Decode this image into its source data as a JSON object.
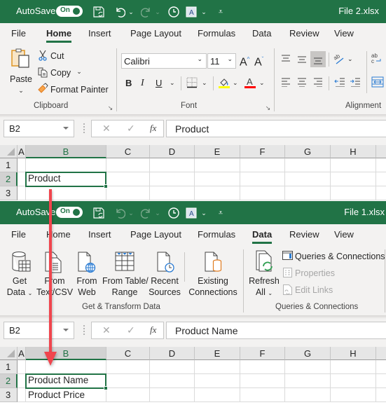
{
  "windows": [
    {
      "title_bar": {
        "autosave_label": "AutoSave",
        "autosave_state": "On",
        "file_name": "File 2.xlsx",
        "qat_icons": [
          "save-sync-icon",
          "undo-icon",
          "redo-icon",
          "history-icon",
          "format-icon",
          "customize-icon"
        ]
      },
      "tabs": [
        {
          "label": "File",
          "active": false
        },
        {
          "label": "Home",
          "active": true
        },
        {
          "label": "Insert",
          "active": false
        },
        {
          "label": "Page Layout",
          "active": false
        },
        {
          "label": "Formulas",
          "active": false
        },
        {
          "label": "Data",
          "active": false
        },
        {
          "label": "Review",
          "active": false
        },
        {
          "label": "View",
          "active": false
        }
      ],
      "ribbon": {
        "clipboard": {
          "paste": "Paste",
          "cut": "Cut",
          "copy": "Copy",
          "format_painter": "Format Painter",
          "group_label": "Clipboard"
        },
        "font": {
          "font_name": "Calibri",
          "font_size": "11",
          "bold": "B",
          "italic": "I",
          "underline": "U",
          "highlight_color": "#ffff00",
          "font_color": "#ff0000",
          "group_label": "Font"
        },
        "alignment": {
          "group_label": "Alignment"
        }
      },
      "formula_bar": {
        "name_box": "B2",
        "cancel": "✕",
        "enter": "✓",
        "fx": "fx",
        "value": "Product"
      },
      "grid": {
        "columns": [
          "A",
          "B",
          "C",
          "D",
          "E",
          "F",
          "G",
          "H"
        ],
        "rows": [
          "1",
          "2",
          "3"
        ],
        "active_cell": "B2",
        "cells": {
          "B2": "Product"
        }
      }
    },
    {
      "title_bar": {
        "autosave_label": "AutoSave",
        "autosave_state": "On",
        "file_name": "File 1.xlsx",
        "qat_icons": [
          "save-sync-icon",
          "undo-icon",
          "redo-icon",
          "history-icon",
          "format-icon",
          "customize-icon"
        ]
      },
      "tabs": [
        {
          "label": "File",
          "active": false
        },
        {
          "label": "Home",
          "active": false
        },
        {
          "label": "Insert",
          "active": false
        },
        {
          "label": "Page Layout",
          "active": false
        },
        {
          "label": "Formulas",
          "active": false
        },
        {
          "label": "Data",
          "active": true
        },
        {
          "label": "Review",
          "active": false
        },
        {
          "label": "View",
          "active": false
        }
      ],
      "ribbon": {
        "get_transform": {
          "get_data": [
            "Get",
            "Data"
          ],
          "from_text_csv": [
            "From",
            "Text/CSV"
          ],
          "from_web": [
            "From",
            "Web"
          ],
          "from_table_range": [
            "From Table/",
            "Range"
          ],
          "recent_sources": [
            "Recent",
            "Sources"
          ],
          "existing_connections": [
            "Existing",
            "Connections"
          ],
          "group_label": "Get & Transform Data"
        },
        "queries_connections": {
          "refresh_all": [
            "Refresh",
            "All"
          ],
          "queries_connections": "Queries & Connections",
          "properties": "Properties",
          "edit_links": "Edit Links",
          "group_label": "Queries & Connections"
        }
      },
      "formula_bar": {
        "name_box": "B2",
        "cancel": "✕",
        "enter": "✓",
        "fx": "fx",
        "value": "Product Name"
      },
      "grid": {
        "columns": [
          "A",
          "B",
          "C",
          "D",
          "E",
          "F",
          "G",
          "H"
        ],
        "rows": [
          "1",
          "2",
          "3"
        ],
        "active_cell": "B2",
        "cells": {
          "B2": "Product Name",
          "B3": "Product Price"
        }
      }
    }
  ],
  "annotation": {
    "arrow_color": "#f0454d",
    "meaning": "arrow from File 2 B2 to File 1 B1"
  },
  "colors": {
    "excel_green": "#217346",
    "ribbon_bg": "#f3f2f1"
  }
}
